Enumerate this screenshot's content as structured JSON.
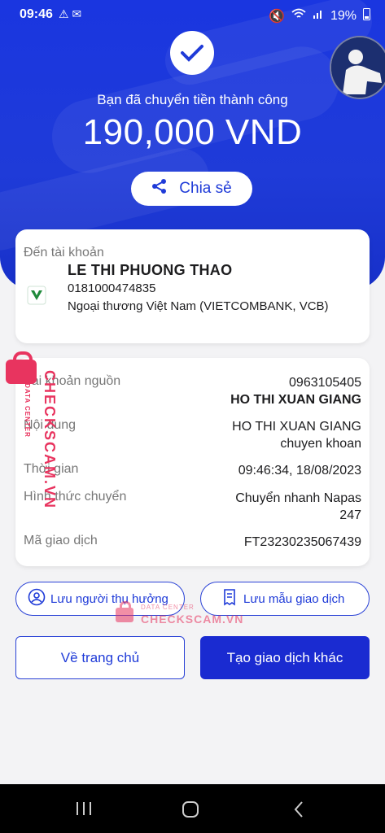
{
  "status_bar": {
    "time": "09:46",
    "battery": "19%"
  },
  "header": {
    "success_text": "Bạn đã chuyển tiền thành công",
    "amount": "190,000 VND",
    "share_label": "Chia sẻ"
  },
  "destination": {
    "label": "Đến tài khoản",
    "name": "LE THI PHUONG THAO",
    "account": "0181000474835",
    "bank": "Ngoại thương Việt Nam (VIETCOMBANK, VCB)"
  },
  "details": {
    "source_label": "Tài khoản nguồn",
    "source_account": "0963105405",
    "source_name": "HO THI XUAN GIANG",
    "content_label": "Nội dung",
    "content_line1": "HO THI XUAN GIANG",
    "content_line2": "chuyen khoan",
    "time_label": "Thời gian",
    "time_value": "09:46:34, 18/08/2023",
    "method_label": "Hình thức chuyển",
    "method_line1": "Chuyển nhanh Napas",
    "method_line2": "247",
    "txid_label": "Mã giao dịch",
    "txid_value": "FT23230235067439"
  },
  "actions": {
    "save_beneficiary": "Lưu người thụ hưởng",
    "save_template": "Lưu mẫu giao dịch",
    "home": "Về trang chủ",
    "new_transaction": "Tạo giao dịch khác"
  },
  "watermark": {
    "brand": "CHECKSCAM.VN",
    "sub": "DATA CENTER"
  },
  "colors": {
    "primary": "#1f3bd8",
    "watermark": "#e8345f"
  }
}
